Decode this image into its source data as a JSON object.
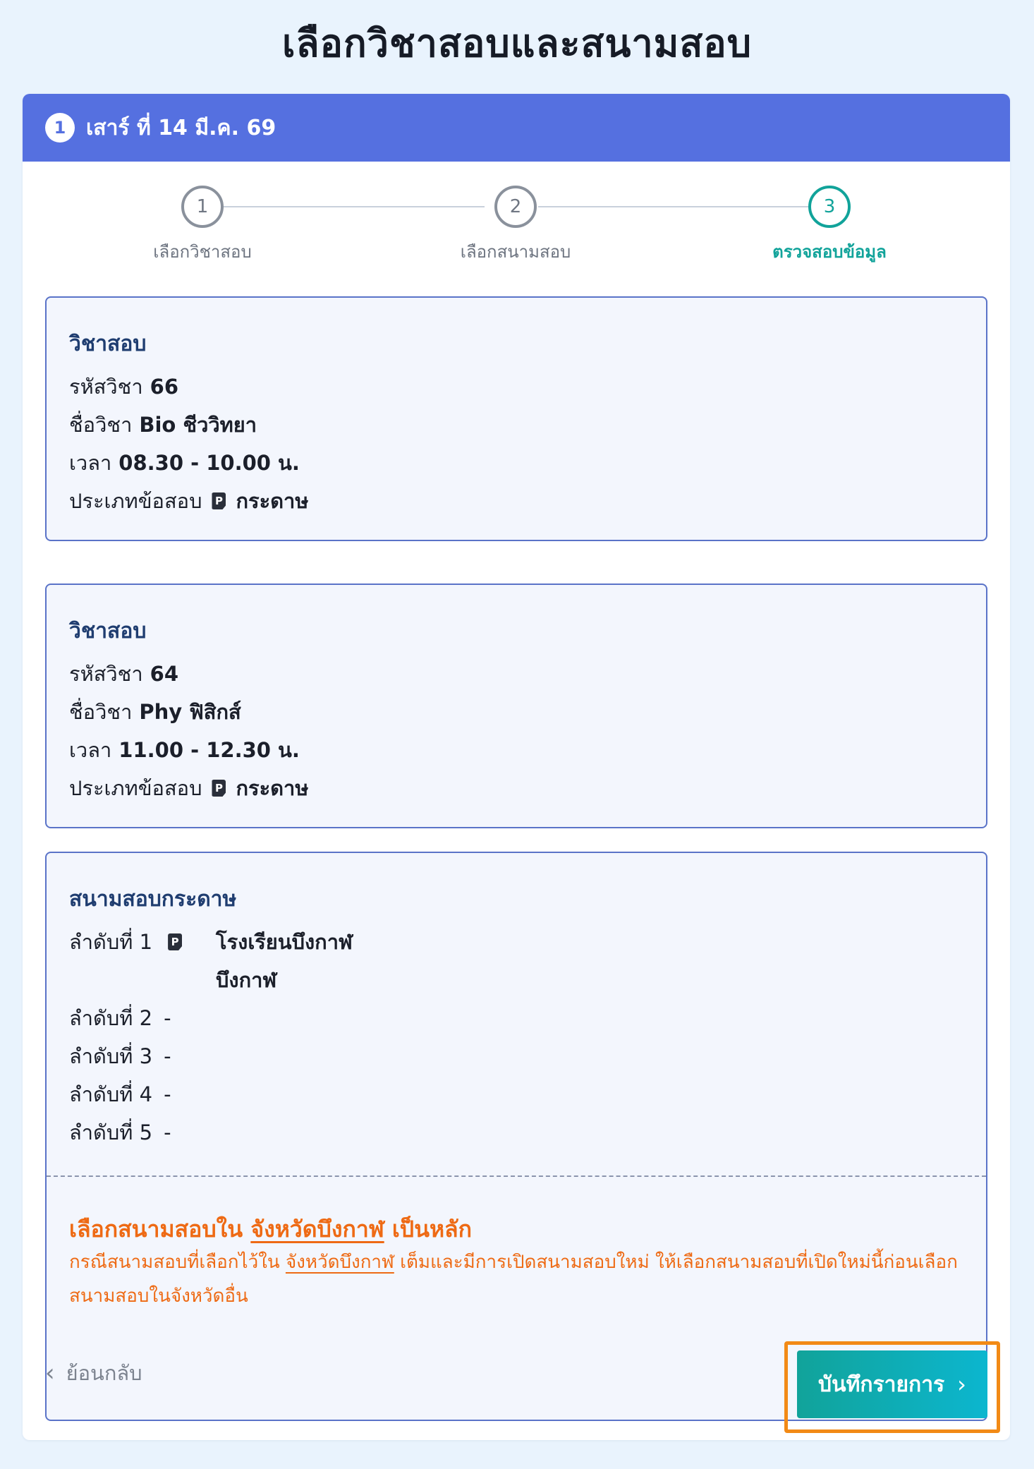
{
  "page": {
    "title": "เลือกวิชาสอบและสนามสอบ"
  },
  "header": {
    "number": "1",
    "text": "เสาร์ ที่ 14 มี.ค. 69"
  },
  "stepper": {
    "steps": [
      {
        "number": "1",
        "label": "เลือกวิชาสอบ",
        "active": false
      },
      {
        "number": "2",
        "label": "เลือกสนามสอบ",
        "active": false
      },
      {
        "number": "3",
        "label": "ตรวจสอบข้อมูล",
        "active": true
      }
    ]
  },
  "subjects": [
    {
      "title": "วิชาสอบ",
      "code_label": "รหัสวิชา",
      "code": "66",
      "name_label": "ชื่อวิชา",
      "name": "Bio ชีววิทยา",
      "time_label": "เวลา",
      "time": "08.30 - 10.00 น.",
      "type_label": "ประเภทข้อสอบ",
      "type_icon": "P",
      "type": "กระดาษ"
    },
    {
      "title": "วิชาสอบ",
      "code_label": "รหัสวิชา",
      "code": "64",
      "name_label": "ชื่อวิชา",
      "name": "Phy ฟิสิกส์",
      "time_label": "เวลา",
      "time": "11.00 - 12.30 น.",
      "type_label": "ประเภทข้อสอบ",
      "type_icon": "P",
      "type": "กระดาษ"
    }
  ],
  "venues": {
    "title": "สนามสอบกระดาษ",
    "items": [
      {
        "label": "ลำดับที่ 1",
        "icon": "P",
        "name_line1": "โรงเรียนบึงกาฬ",
        "name_line2": "บึงกาฬ"
      },
      {
        "label": "ลำดับที่ 2",
        "value": "-"
      },
      {
        "label": "ลำดับที่ 3",
        "value": "-"
      },
      {
        "label": "ลำดับที่ 4",
        "value": "-"
      },
      {
        "label": "ลำดับที่ 5",
        "value": "-"
      }
    ],
    "note": {
      "title_pre": "เลือกสนามสอบใน",
      "title_province": "จังหวัดบึงกาฬ",
      "title_post": "เป็นหลัก",
      "text_pre": "กรณีสนามสอบที่เลือกไว้ใน",
      "text_province": "จังหวัดบึงกาฬ",
      "text_post": "เต็มและมีการเปิดสนามสอบใหม่ ให้เลือกสนามสอบที่เปิดใหม่นี้ก่อนเลือกสนามสอบในจังหวัดอื่น"
    }
  },
  "actions": {
    "back_label": "ย้อนกลับ",
    "save_label": "บันทึกรายการ"
  },
  "colors": {
    "header": "#5570e0",
    "active_step": "#11a39a",
    "note": "#ee6a14",
    "highlight": "#f28a16"
  }
}
